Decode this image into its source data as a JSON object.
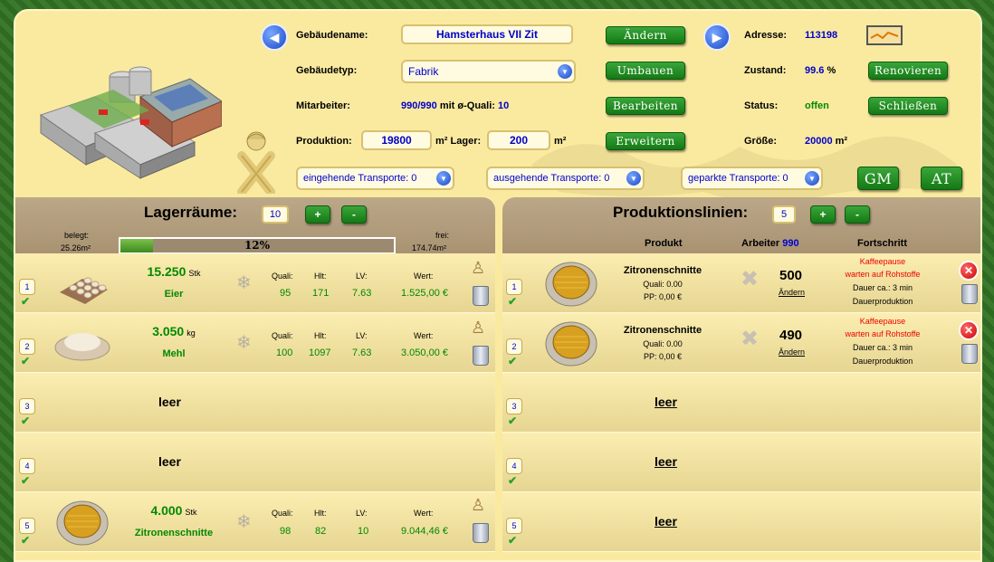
{
  "header": {
    "building_name_label": "Gebäudename:",
    "building_name": "Hamsterhaus VII Zit",
    "change_btn": "Ändern",
    "building_type_label": "Gebäudetyp:",
    "building_type": "Fabrik",
    "rebuild_btn": "Umbauen",
    "staff_label": "Mitarbeiter:",
    "staff_value": "990/990",
    "staff_mid": "mit ø-Quali:",
    "staff_quali": "10",
    "edit_btn": "Bearbeiten",
    "production_label": "Produktion:",
    "production_value": "19800",
    "production_unit": "m²",
    "storage_label": "Lager:",
    "storage_value": "200",
    "storage_unit": "m²",
    "expand_btn": "Erweitern",
    "address_label": "Adresse:",
    "address_value": "113198",
    "condition_label": "Zustand:",
    "condition_value": "99.6",
    "condition_unit": "%",
    "renovate_btn": "Renovieren",
    "status_label": "Status:",
    "status_value": "offen",
    "close_btn": "Schließen",
    "size_label": "Größe:",
    "size_value": "20000",
    "size_unit": "m²",
    "transport_in": "eingehende Transporte: 0",
    "transport_out": "ausgehende Transporte: 0",
    "transport_parked": "geparkte Transporte: 0",
    "gm_btn": "GM",
    "at_btn": "AT"
  },
  "storage": {
    "title": "Lagerräume:",
    "count": "10",
    "plus": "+",
    "minus": "-",
    "used_label": "belegt:",
    "used_value": "25.26m²",
    "fill_percent_text": "12%",
    "fill_fraction": 0.12,
    "free_label": "frei:",
    "free_value": "174.74m²",
    "col_quali": "Quali:",
    "col_hlt": "Hlt:",
    "col_lv": "LV:",
    "col_wert": "Wert:",
    "rows": [
      {
        "slot": "1",
        "amount": "15.250",
        "unit": "Stk",
        "name": "Eier",
        "quali": "95",
        "hlt": "171",
        "lv": "7.63",
        "wert": "1.525,00 €"
      },
      {
        "slot": "2",
        "amount": "3.050",
        "unit": "kg",
        "name": "Mehl",
        "quali": "100",
        "hlt": "1097",
        "lv": "7.63",
        "wert": "3.050,00 €"
      },
      {
        "slot": "3",
        "empty": "leer"
      },
      {
        "slot": "4",
        "empty": "leer"
      },
      {
        "slot": "5",
        "amount": "4.000",
        "unit": "Stk",
        "name": "Zitronenschnitte",
        "quali": "98",
        "hlt": "82",
        "lv": "10",
        "wert": "9.044,46 €"
      }
    ]
  },
  "production": {
    "title": "Produktionslinien:",
    "count": "5",
    "plus": "+",
    "minus": "-",
    "col_product": "Produkt",
    "col_workers": "Arbeiter",
    "col_workers_value": "990",
    "col_progress": "Fortschritt",
    "rows": [
      {
        "slot": "1",
        "product": "Zitronenschnitte",
        "quali": "Quali: 0.00",
        "pp": "PP: 0,00 €",
        "workers": "500",
        "change": "Ändern",
        "status1": "Kaffeepause",
        "status2": "warten auf Rohstoffe",
        "duration": "Dauer ca.: 3 min",
        "mode": "Dauerproduktion"
      },
      {
        "slot": "2",
        "product": "Zitronenschnitte",
        "quali": "Quali: 0.00",
        "pp": "PP: 0,00 €",
        "workers": "490",
        "change": "Ändern",
        "status1": "Kaffeepause",
        "status2": "warten auf Rohstoffe",
        "duration": "Dauer ca.: 3 min",
        "mode": "Dauerproduktion"
      },
      {
        "slot": "3",
        "empty": "leer"
      },
      {
        "slot": "4",
        "empty": "leer"
      },
      {
        "slot": "5",
        "empty": "leer"
      }
    ]
  },
  "colors": {
    "accent_green": "#147a14",
    "value_blue": "#0000cc",
    "alert_red": "#ee0000"
  }
}
